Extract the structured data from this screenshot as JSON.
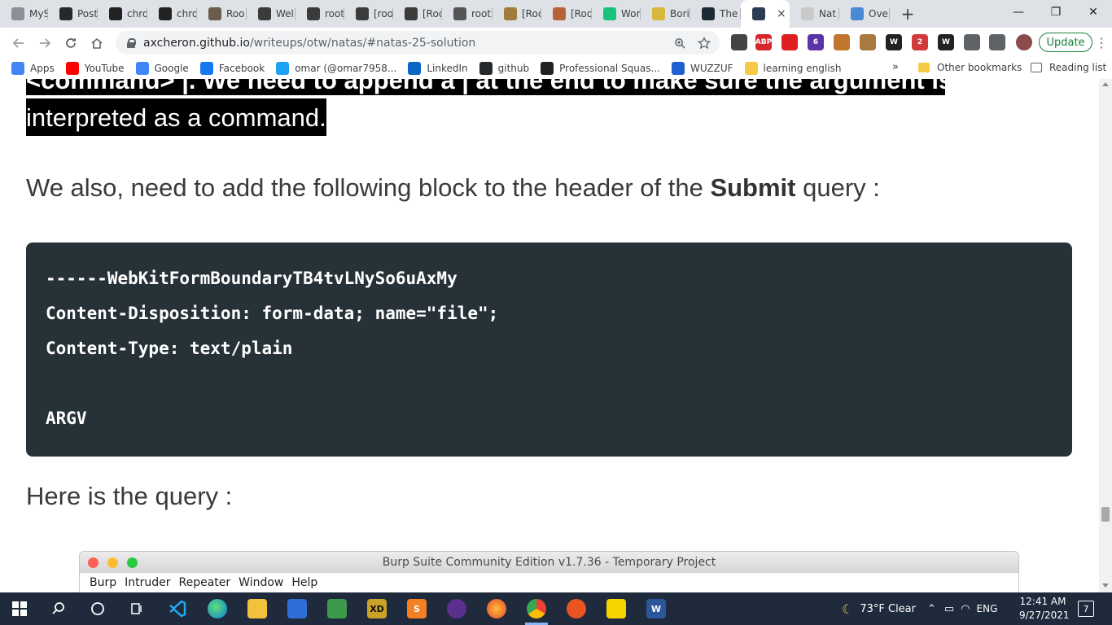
{
  "tabs": [
    {
      "title": "MyS",
      "fav": "page-icon",
      "color": "#8a8f98"
    },
    {
      "title": "Post",
      "fav": "github-icon",
      "color": "#24292e"
    },
    {
      "title": "chro",
      "fav": "wikipedia-icon",
      "color": "#222"
    },
    {
      "title": "chro",
      "fav": "wikipedia-icon",
      "color": "#222"
    },
    {
      "title": "Roo",
      "fav": "tryhackme-icon",
      "color": "#6b5c4b"
    },
    {
      "title": "Wel",
      "fav": "dots-icon",
      "color": "#3b3b3b"
    },
    {
      "title": "root",
      "fav": "dots-icon",
      "color": "#3b3b3b"
    },
    {
      "title": "[roo",
      "fav": "dots-icon",
      "color": "#3b3b3b"
    },
    {
      "title": "[Roo",
      "fav": "dots-icon",
      "color": "#3b3b3b"
    },
    {
      "title": "root",
      "fav": "hackthebox-icon",
      "color": "#555"
    },
    {
      "title": "[Roo",
      "fav": "robot-icon",
      "color": "#a07d3a"
    },
    {
      "title": "[Roo",
      "fav": "monkey-icon",
      "color": "#b5623a"
    },
    {
      "title": "Wor",
      "fav": "pastebin-icon",
      "color": "#19c37d"
    },
    {
      "title": "Bori",
      "fav": "spongebob-icon",
      "color": "#d8b73b"
    },
    {
      "title": "The",
      "fav": "hood-icon",
      "color": "#1c2a36"
    },
    {
      "title": "",
      "fav": "hat-icon",
      "color": "#2b3d55",
      "active": true
    },
    {
      "title": "Nat",
      "fav": "note-icon",
      "color": "#c9c9c9"
    },
    {
      "title": "Ove",
      "fav": "shield-icon",
      "color": "#4a8ad4"
    }
  ],
  "tab_close": "×",
  "new_tab": "+",
  "window_controls": {
    "minimize": "—",
    "maximize": "❐",
    "close": "✕"
  },
  "toolbar": {
    "url_host": "axcheron.github.io",
    "url_path": "/writeups/otw/natas/#natas-25-solution",
    "update_label": "Update"
  },
  "extensions": [
    {
      "name": "ghost-extension-icon",
      "color": "#444",
      "label": ""
    },
    {
      "name": "adblock-plus-icon",
      "color": "#d7262d",
      "label": "ABP"
    },
    {
      "name": "adblock-icon",
      "color": "#e02020",
      "label": ""
    },
    {
      "name": "hexagon-extension-icon",
      "color": "#5a33a8",
      "label": "6"
    },
    {
      "name": "basket-extension-icon",
      "color": "#c0762c",
      "label": ""
    },
    {
      "name": "cookie-extension-icon",
      "color": "#a9793d",
      "label": ""
    },
    {
      "name": "wappalyzer-icon",
      "color": "#222",
      "label": "W"
    },
    {
      "name": "tag-extension-icon",
      "color": "#d03a3a",
      "label": "2"
    },
    {
      "name": "wikipedia-extension-icon",
      "color": "#222",
      "label": "W"
    },
    {
      "name": "puzzle-icon",
      "color": "#5f6368",
      "label": ""
    },
    {
      "name": "playlist-icon",
      "color": "#5f6368",
      "label": ""
    },
    {
      "name": "profile-avatar",
      "color": "#8a4b4b",
      "label": ""
    }
  ],
  "bookmarks": [
    {
      "label": "Apps",
      "icon": "apps-grid-icon",
      "color": "#4285f4"
    },
    {
      "label": "YouTube",
      "icon": "youtube-icon",
      "color": "#ff0000"
    },
    {
      "label": "Google",
      "icon": "google-icon",
      "color": "#4285f4"
    },
    {
      "label": "Facebook",
      "icon": "facebook-icon",
      "color": "#1877f2"
    },
    {
      "label": "omar (@omar7958...",
      "icon": "twitter-icon",
      "color": "#1da1f2"
    },
    {
      "label": "LinkedIn",
      "icon": "linkedin-icon",
      "color": "#0a66c2"
    },
    {
      "label": "github",
      "icon": "github-icon",
      "color": "#24292e"
    },
    {
      "label": "Professional Squas...",
      "icon": "squash-icon",
      "color": "#222"
    },
    {
      "label": "WUZZUF",
      "icon": "wuzzuf-icon",
      "color": "#1f5fcf"
    },
    {
      "label": "learning english",
      "icon": "folder-icon",
      "color": "#f7c948"
    }
  ],
  "bookmarks_overflow": "»",
  "other_bookmarks": "Other bookmarks",
  "reading_list": "Reading list",
  "content": {
    "highlight_line1": "<command> |. We need to append a | at the end to make sure the argument is",
    "highlight_line2": "interpreted as a command.",
    "para1_before": "We also, need to add the following block to the header of the ",
    "para1_bold": "Submit",
    "para1_after": " query :",
    "code_lines": [
      "------WebKitFormBoundaryTB4tvLNySo6uAxMy",
      "Content-Disposition: form-data; name=\"file\";",
      "Content-Type: text/plain",
      "",
      "ARGV"
    ],
    "para2": "Here is the query :"
  },
  "burp": {
    "title": "Burp Suite Community Edition v1.7.36 - Temporary Project",
    "menu": [
      "Burp",
      "Intruder",
      "Repeater",
      "Window",
      "Help"
    ]
  },
  "taskbar": {
    "weather": "73°F  Clear",
    "lang": "ENG",
    "time": "12:41 AM",
    "date": "9/27/2021",
    "notifications": "7"
  }
}
